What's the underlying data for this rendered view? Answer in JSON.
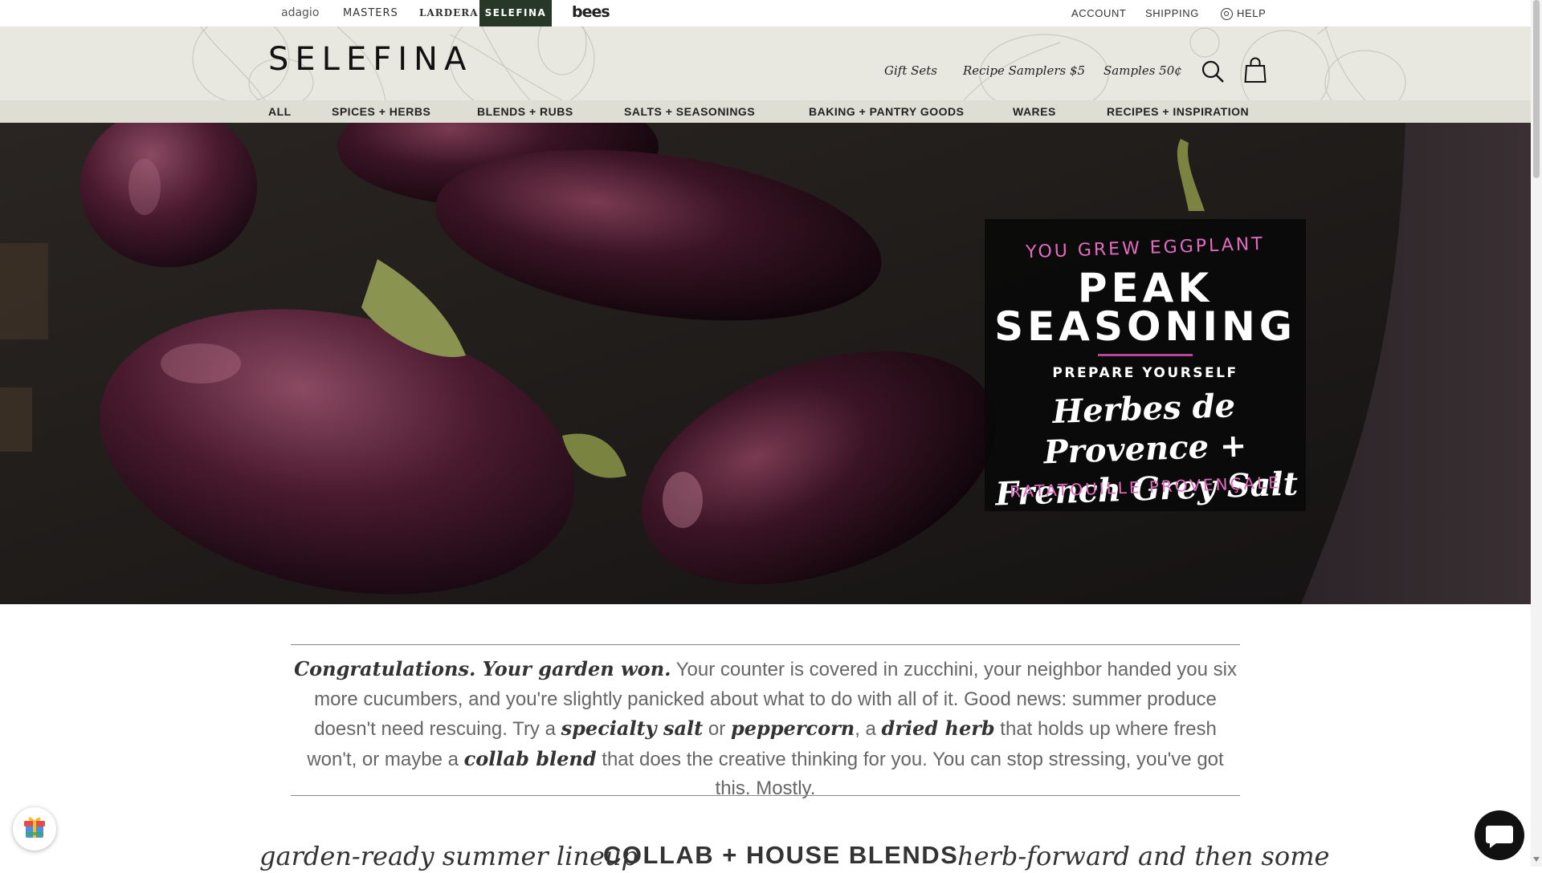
{
  "brand_bar": {
    "brands": [
      "adagio",
      "MASTERS",
      "LARDERA",
      "SELEFINA",
      "bees"
    ],
    "active_brand": "SELEFINA",
    "account": "ACCOUNT",
    "shipping": "SHIPPING",
    "help": "HELP"
  },
  "header": {
    "logo": "SELEFINA",
    "links": [
      "Gift Sets",
      "Recipe Samplers $5",
      "Samples 50¢"
    ],
    "icons": [
      "search-icon",
      "shopping-bag-icon"
    ]
  },
  "nav": {
    "items": [
      "ALL",
      "SPICES + HERBS",
      "BLENDS + RUBS",
      "SALTS + SEASONINGS",
      "BAKING + PANTRY GOODS",
      "WARES",
      "RECIPES + INSPIRATION"
    ]
  },
  "hero": {
    "kicker": "YOU GREW EGGPLANT",
    "title_line1": "PEAK",
    "title_line2": "SEASONING",
    "subtitle": "PREPARE YOURSELF",
    "script_line1": "Herbes de Provence +",
    "script_line2": "French Grey Salt",
    "footer": "RATATOUILLE PROVENÇALE"
  },
  "intro": {
    "lead": "Congratulations. Your garden won.",
    "text1": " Your counter is covered in zucchini, your neighbor handed you six more cucumbers, and you're slightly panicked about what to do with all of it. Good news: summer produce doesn't need rescuing. Try a ",
    "em1": "specialty salt",
    "text2": " or ",
    "em2": "peppercorn",
    "text3": ", a ",
    "em3": "dried herb",
    "text4": " that holds up where fresh won't, or maybe a ",
    "em4": "collab blend",
    "text5": " that does the creative thinking for you. You can stop stressing, you've got this. Mostly."
  },
  "sections": {
    "tabs": [
      "garden-ready summer lineup",
      "COLLAB + HOUSE BLENDS",
      "herb-forward and then some"
    ]
  },
  "colors": {
    "header_bg": "#e8e8e0",
    "nav_bg": "#deded4",
    "active_brand_bg": "#283828",
    "accent_pink": "#e06cc0"
  }
}
